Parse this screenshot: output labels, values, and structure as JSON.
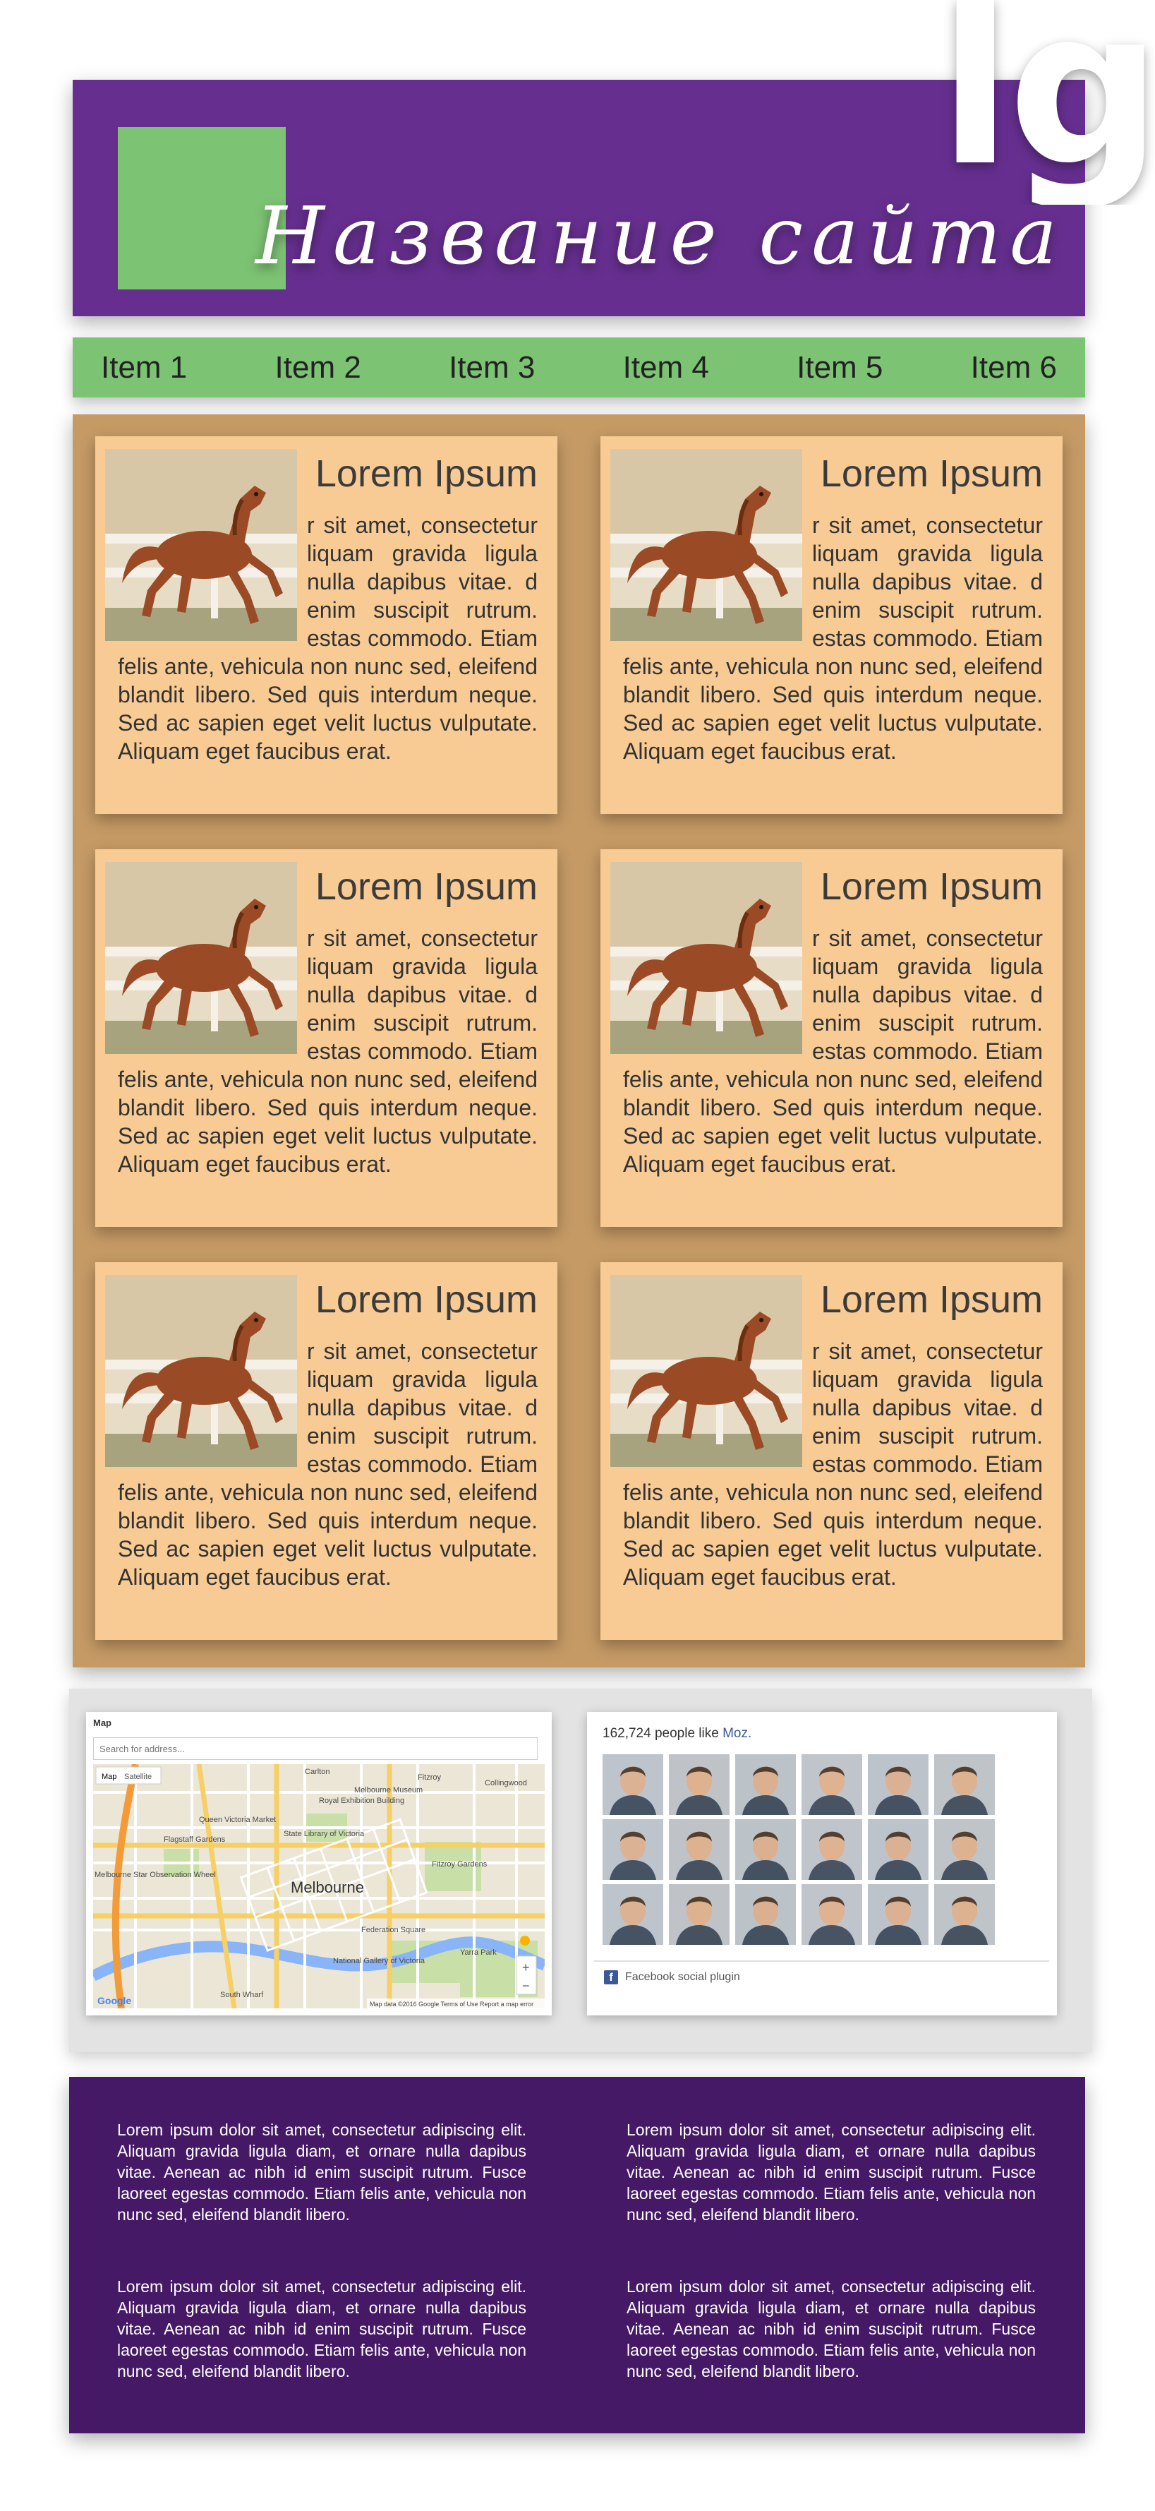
{
  "header": {
    "site_title": "Название сайта",
    "brand_mark": "lg",
    "logo_color": "#7dc374",
    "background_color": "#662f8f"
  },
  "nav": {
    "items": [
      {
        "label": "Item 1"
      },
      {
        "label": "Item 2"
      },
      {
        "label": "Item 3"
      },
      {
        "label": "Item 4"
      },
      {
        "label": "Item 5"
      },
      {
        "label": "Item 6"
      }
    ]
  },
  "content": {
    "cards": [
      {
        "title": "Lorem Ipsum",
        "image": "horse-image",
        "body": "r sit amet, consectetur liquam gravida ligula nulla dapibus vitae. d enim suscipit rutrum. estas commodo. Etiam felis ante, vehicula non nunc sed, eleifend blandit libero. Sed quis interdum neque. Sed ac sapien eget velit luctus vulputate. Aliquam eget faucibus erat."
      },
      {
        "title": "Lorem Ipsum",
        "image": "horse-image",
        "body": "r sit amet, consectetur liquam gravida ligula nulla dapibus vitae. d enim suscipit rutrum. estas commodo. Etiam felis ante, vehicula non nunc sed, eleifend blandit libero. Sed quis interdum neque. Sed ac sapien eget velit luctus vulputate. Aliquam eget faucibus erat."
      },
      {
        "title": "Lorem Ipsum",
        "image": "horse-image",
        "body": "r sit amet, consectetur liquam gravida ligula nulla dapibus vitae. d enim suscipit rutrum. estas commodo. Etiam felis ante, vehicula non nunc sed, eleifend blandit libero. Sed quis interdum neque. Sed ac sapien eget velit luctus vulputate. Aliquam eget faucibus erat."
      },
      {
        "title": "Lorem Ipsum",
        "image": "horse-image",
        "body": "r sit amet, consectetur liquam gravida ligula nulla dapibus vitae. d enim suscipit rutrum. estas commodo. Etiam felis ante, vehicula non nunc sed, eleifend blandit libero. Sed quis interdum neque. Sed ac sapien eget velit luctus vulputate. Aliquam eget faucibus erat."
      },
      {
        "title": "Lorem Ipsum",
        "image": "horse-image",
        "body": "r sit amet, consectetur liquam gravida ligula nulla dapibus vitae. d enim suscipit rutrum. estas commodo. Etiam felis ante, vehicula non nunc sed, eleifend blandit libero. Sed quis interdum neque. Sed ac sapien eget velit luctus vulputate. Aliquam eget faucibus erat."
      },
      {
        "title": "Lorem Ipsum",
        "image": "horse-image",
        "body": "r sit amet, consectetur liquam gravida ligula nulla dapibus vitae. d enim suscipit rutrum. estas commodo. Etiam felis ante, vehicula non nunc sed, eleifend blandit libero. Sed quis interdum neque. Sed ac sapien eget velit luctus vulputate. Aliquam eget faucibus erat."
      }
    ]
  },
  "widgets": {
    "map": {
      "label": "Map",
      "search_placeholder": "Search for address...",
      "type_map": "Map",
      "type_satellite": "Satellite",
      "city_label": "Melbourne",
      "places": [
        "Carlton",
        "Fitzroy",
        "Collingwood",
        "Royal Exhibition Building",
        "Melbourne Museum",
        "Queen Victoria Market",
        "State Library of Victoria",
        "Flagstaff Gardens",
        "Melbourne Star Observation Wheel",
        "Fitzroy Gardens",
        "Federation Square",
        "National Gallery of Victoria",
        "Yarra Park",
        "South Wharf"
      ],
      "zoom_in": "+",
      "zoom_out": "−",
      "google_label": "Google",
      "attribution": "Map data ©2016 Google   Terms of Use   Report a map error"
    },
    "facebook": {
      "count_text": "162,724 people like ",
      "page_name": "Moz.",
      "faces_count": 18,
      "footer_text": "Facebook social plugin",
      "logo_letter": "f",
      "brand_color": "#3b5998"
    }
  },
  "footer": {
    "paragraphs": [
      "Lorem ipsum dolor sit amet, consectetur adipiscing elit. Aliquam gravida ligula diam, et ornare nulla dapibus vitae. Aenean ac nibh id enim suscipit rutrum. Fusce laoreet egestas commodo. Etiam felis ante, vehicula non nunc sed, eleifend blandit libero.",
      "Lorem ipsum dolor sit amet, consectetur adipiscing elit. Aliquam gravida ligula diam, et ornare nulla dapibus vitae. Aenean ac nibh id enim suscipit rutrum. Fusce laoreet egestas commodo. Etiam felis ante, vehicula non nunc sed, eleifend blandit libero.",
      "Lorem ipsum dolor sit amet, consectetur adipiscing elit. Aliquam gravida ligula diam, et ornare nulla dapibus vitae. Aenean ac nibh id enim suscipit rutrum. Fusce laoreet egestas commodo. Etiam felis ante, vehicula non nunc sed, eleifend blandit libero.",
      "Lorem ipsum dolor sit amet, consectetur adipiscing elit. Aliquam gravida ligula diam, et ornare nulla dapibus vitae. Aenean ac nibh id enim suscipit rutrum. Fusce laoreet egestas commodo. Etiam felis ante, vehicula non nunc sed, eleifend blandit libero."
    ]
  }
}
